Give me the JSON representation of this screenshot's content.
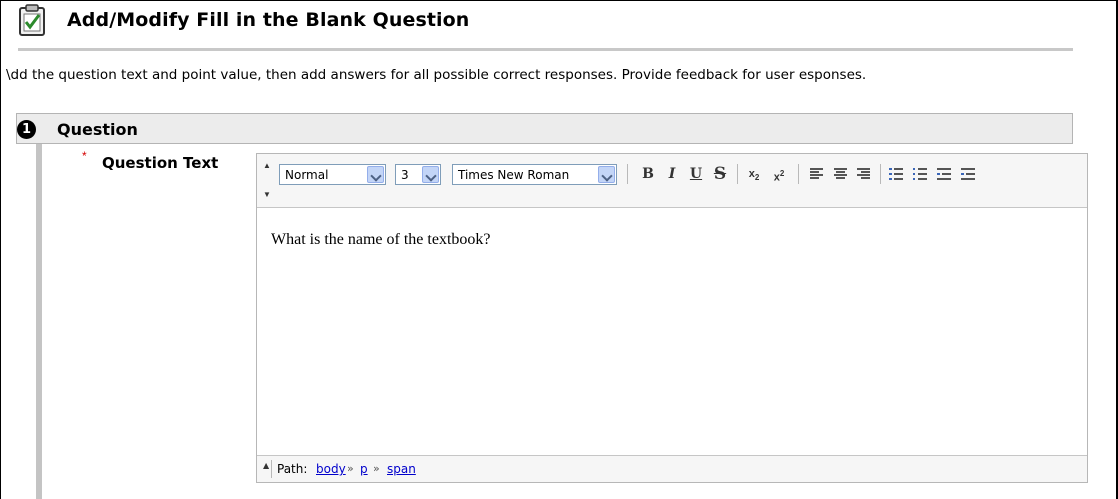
{
  "header": {
    "title": "Add/Modify Fill in the Blank Question",
    "icon": "clipboard-check-icon"
  },
  "instructions": "\\dd the question text and point value, then add answers for all possible correct responses. Provide feedback for user esponses.",
  "section": {
    "step_number": "1",
    "title": "Question"
  },
  "field": {
    "required_marker": "*",
    "label": "Question Text"
  },
  "editor": {
    "style_select": "Normal",
    "size_select": "3",
    "font_select": "Times New Roman",
    "buttons": {
      "bold": "B",
      "italic": "I",
      "underline": "U",
      "strike": "S",
      "subscript": "x",
      "superscript": "x",
      "sub_mark": "2",
      "sup_mark": "2"
    },
    "content": "What is the name of the textbook?",
    "path_label": "Path:",
    "path": [
      "body",
      "p",
      "span"
    ],
    "path_separator": "»",
    "expand_glyph": "▲",
    "collapse_glyph": "▼"
  },
  "colors": {
    "required": "#d40000",
    "link": "#0000cc",
    "section_bg": "#ececec"
  }
}
